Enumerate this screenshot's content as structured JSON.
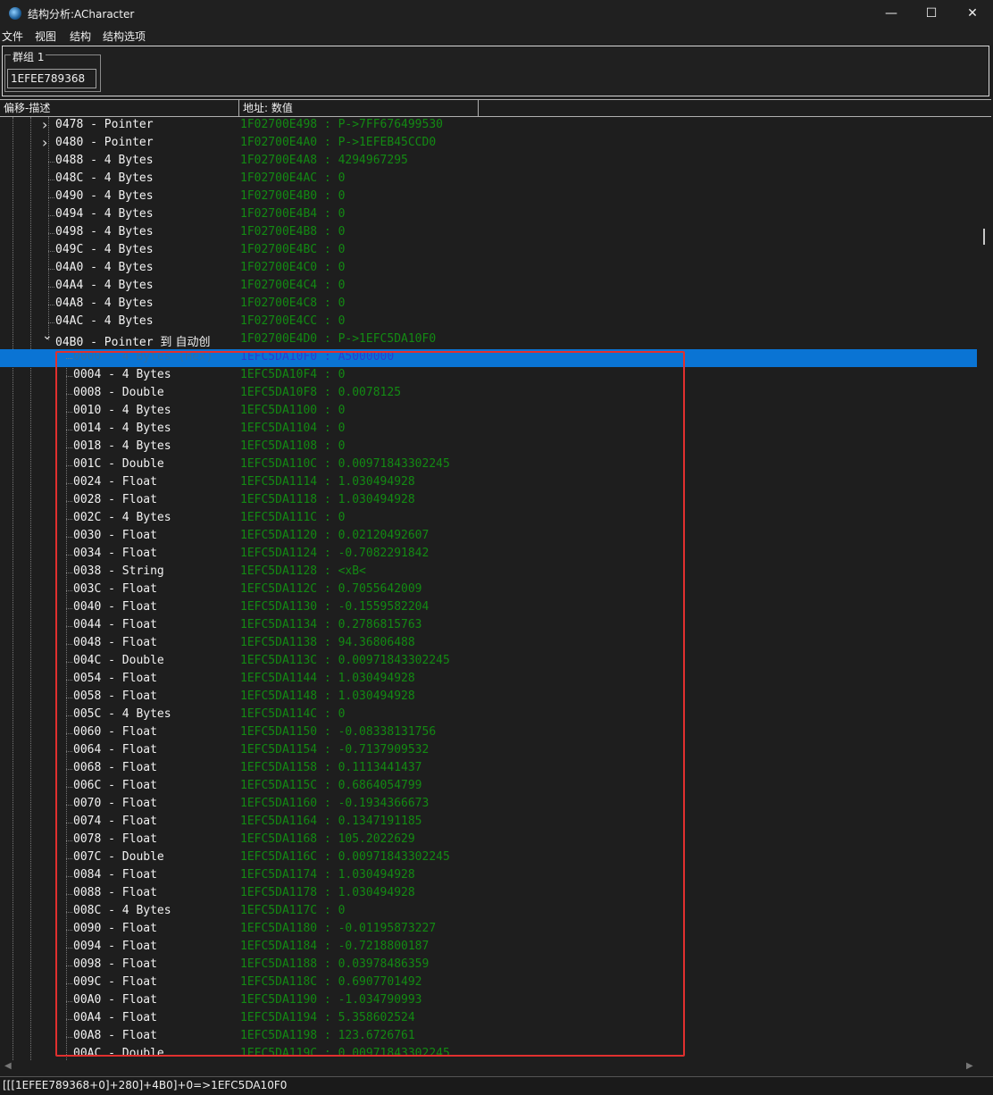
{
  "window": {
    "title": "结构分析:ACharacter",
    "minimize": "—",
    "maximize": "☐",
    "close": "✕"
  },
  "menu": [
    "文件",
    "视图",
    "结构",
    "结构选项"
  ],
  "group": {
    "label": "群组 1",
    "address": "1EFEE789368"
  },
  "columns": {
    "offset_desc": "偏移-描述",
    "address_value": "地址: 数值"
  },
  "rows": [
    {
      "offset": "0478",
      "desc": "Pointer",
      "address": "1F02700E498",
      "value": "P->7FF676499530",
      "expander": "collapsed",
      "level": 1
    },
    {
      "offset": "0480",
      "desc": "Pointer",
      "address": "1F02700E4A0",
      "value": "P->1EFEB45CCD0",
      "expander": "collapsed",
      "level": 1
    },
    {
      "offset": "0488",
      "desc": "4 Bytes",
      "address": "1F02700E4A8",
      "value": "4294967295",
      "level": 1
    },
    {
      "offset": "048C",
      "desc": "4 Bytes",
      "address": "1F02700E4AC",
      "value": "0",
      "level": 1
    },
    {
      "offset": "0490",
      "desc": "4 Bytes",
      "address": "1F02700E4B0",
      "value": "0",
      "level": 1
    },
    {
      "offset": "0494",
      "desc": "4 Bytes",
      "address": "1F02700E4B4",
      "value": "0",
      "level": 1
    },
    {
      "offset": "0498",
      "desc": "4 Bytes",
      "address": "1F02700E4B8",
      "value": "0",
      "level": 1
    },
    {
      "offset": "049C",
      "desc": "4 Bytes",
      "address": "1F02700E4BC",
      "value": "0",
      "level": 1
    },
    {
      "offset": "04A0",
      "desc": "4 Bytes",
      "address": "1F02700E4C0",
      "value": "0",
      "level": 1
    },
    {
      "offset": "04A4",
      "desc": "4 Bytes",
      "address": "1F02700E4C4",
      "value": "0",
      "level": 1
    },
    {
      "offset": "04A8",
      "desc": "4 Bytes",
      "address": "1F02700E4C8",
      "value": "0",
      "level": 1
    },
    {
      "offset": "04AC",
      "desc": "4 Bytes",
      "address": "1F02700E4CC",
      "value": "0",
      "level": 1
    },
    {
      "offset": "04B0",
      "desc": "Pointer",
      "note": "到 自动创",
      "address": "1F02700E4D0",
      "value": "P->1EFC5DA10F0",
      "expander": "expanded",
      "level": 1
    },
    {
      "offset": "0000",
      "desc": "4 Bytes (Hex)",
      "address": "1EFC5DA10F0",
      "value": "A5000000",
      "level": 2,
      "selected": true
    },
    {
      "offset": "0004",
      "desc": "4 Bytes",
      "address": "1EFC5DA10F4",
      "value": "0",
      "level": 2
    },
    {
      "offset": "0008",
      "desc": "Double",
      "address": "1EFC5DA10F8",
      "value": "0.0078125",
      "level": 2
    },
    {
      "offset": "0010",
      "desc": "4 Bytes",
      "address": "1EFC5DA1100",
      "value": "0",
      "level": 2
    },
    {
      "offset": "0014",
      "desc": "4 Bytes",
      "address": "1EFC5DA1104",
      "value": "0",
      "level": 2
    },
    {
      "offset": "0018",
      "desc": "4 Bytes",
      "address": "1EFC5DA1108",
      "value": "0",
      "level": 2
    },
    {
      "offset": "001C",
      "desc": "Double",
      "address": "1EFC5DA110C",
      "value": "0.00971843302245",
      "level": 2
    },
    {
      "offset": "0024",
      "desc": "Float",
      "address": "1EFC5DA1114",
      "value": "1.030494928",
      "level": 2
    },
    {
      "offset": "0028",
      "desc": "Float",
      "address": "1EFC5DA1118",
      "value": "1.030494928",
      "level": 2
    },
    {
      "offset": "002C",
      "desc": "4 Bytes",
      "address": "1EFC5DA111C",
      "value": "0",
      "level": 2
    },
    {
      "offset": "0030",
      "desc": "Float",
      "address": "1EFC5DA1120",
      "value": "0.02120492607",
      "level": 2
    },
    {
      "offset": "0034",
      "desc": "Float",
      "address": "1EFC5DA1124",
      "value": "-0.7082291842",
      "level": 2
    },
    {
      "offset": "0038",
      "desc": "String",
      "address": "1EFC5DA1128",
      "value": "<xB<",
      "level": 2
    },
    {
      "offset": "003C",
      "desc": "Float",
      "address": "1EFC5DA112C",
      "value": "0.7055642009",
      "level": 2
    },
    {
      "offset": "0040",
      "desc": "Float",
      "address": "1EFC5DA1130",
      "value": "-0.1559582204",
      "level": 2
    },
    {
      "offset": "0044",
      "desc": "Float",
      "address": "1EFC5DA1134",
      "value": "0.2786815763",
      "level": 2
    },
    {
      "offset": "0048",
      "desc": "Float",
      "address": "1EFC5DA1138",
      "value": "94.36806488",
      "level": 2
    },
    {
      "offset": "004C",
      "desc": "Double",
      "address": "1EFC5DA113C",
      "value": "0.00971843302245",
      "level": 2
    },
    {
      "offset": "0054",
      "desc": "Float",
      "address": "1EFC5DA1144",
      "value": "1.030494928",
      "level": 2
    },
    {
      "offset": "0058",
      "desc": "Float",
      "address": "1EFC5DA1148",
      "value": "1.030494928",
      "level": 2
    },
    {
      "offset": "005C",
      "desc": "4 Bytes",
      "address": "1EFC5DA114C",
      "value": "0",
      "level": 2
    },
    {
      "offset": "0060",
      "desc": "Float",
      "address": "1EFC5DA1150",
      "value": "-0.08338131756",
      "level": 2
    },
    {
      "offset": "0064",
      "desc": "Float",
      "address": "1EFC5DA1154",
      "value": "-0.7137909532",
      "level": 2
    },
    {
      "offset": "0068",
      "desc": "Float",
      "address": "1EFC5DA1158",
      "value": "0.1113441437",
      "level": 2
    },
    {
      "offset": "006C",
      "desc": "Float",
      "address": "1EFC5DA115C",
      "value": "0.6864054799",
      "level": 2
    },
    {
      "offset": "0070",
      "desc": "Float",
      "address": "1EFC5DA1160",
      "value": "-0.1934366673",
      "level": 2
    },
    {
      "offset": "0074",
      "desc": "Float",
      "address": "1EFC5DA1164",
      "value": "0.1347191185",
      "level": 2
    },
    {
      "offset": "0078",
      "desc": "Float",
      "address": "1EFC5DA1168",
      "value": "105.2022629",
      "level": 2
    },
    {
      "offset": "007C",
      "desc": "Double",
      "address": "1EFC5DA116C",
      "value": "0.00971843302245",
      "level": 2
    },
    {
      "offset": "0084",
      "desc": "Float",
      "address": "1EFC5DA1174",
      "value": "1.030494928",
      "level": 2
    },
    {
      "offset": "0088",
      "desc": "Float",
      "address": "1EFC5DA1178",
      "value": "1.030494928",
      "level": 2
    },
    {
      "offset": "008C",
      "desc": "4 Bytes",
      "address": "1EFC5DA117C",
      "value": "0",
      "level": 2
    },
    {
      "offset": "0090",
      "desc": "Float",
      "address": "1EFC5DA1180",
      "value": "-0.01195873227",
      "level": 2
    },
    {
      "offset": "0094",
      "desc": "Float",
      "address": "1EFC5DA1184",
      "value": "-0.7218800187",
      "level": 2
    },
    {
      "offset": "0098",
      "desc": "Float",
      "address": "1EFC5DA1188",
      "value": "0.03978486359",
      "level": 2
    },
    {
      "offset": "009C",
      "desc": "Float",
      "address": "1EFC5DA118C",
      "value": "0.6907701492",
      "level": 2
    },
    {
      "offset": "00A0",
      "desc": "Float",
      "address": "1EFC5DA1190",
      "value": "-1.034790993",
      "level": 2
    },
    {
      "offset": "00A4",
      "desc": "Float",
      "address": "1EFC5DA1194",
      "value": "5.358602524",
      "level": 2
    },
    {
      "offset": "00A8",
      "desc": "Float",
      "address": "1EFC5DA1198",
      "value": "123.6726761",
      "level": 2
    },
    {
      "offset": "00AC",
      "desc": "Double",
      "address": "1EFC5DA119C",
      "value": "0.00971843302245",
      "level": 2
    }
  ],
  "status": "[[[1EFEE789368+0]+280]+4B0]+0=>1EFC5DA10F0",
  "colors": {
    "value_green": "#138a13",
    "selection_blue": "#0a74d4",
    "highlight_red": "#e0302f"
  }
}
